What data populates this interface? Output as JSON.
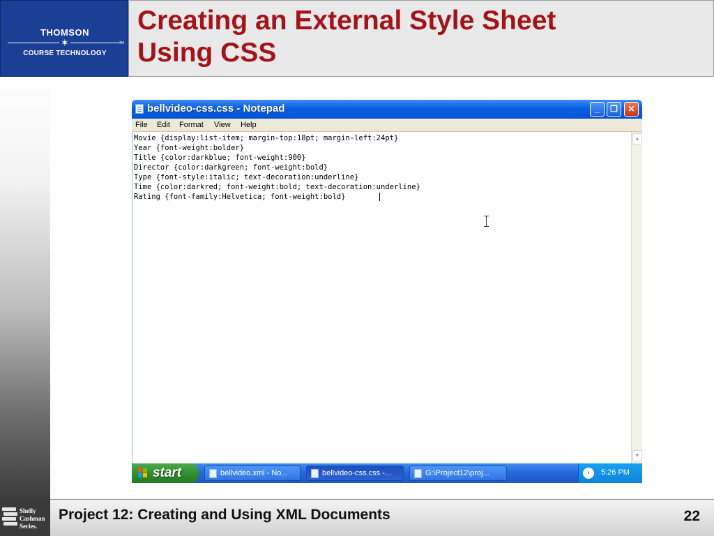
{
  "slide": {
    "logo_top": "THOMSON",
    "logo_bottom": "COURSE TECHNOLOGY",
    "logo_tm": "TM",
    "title_line1": "Creating an External Style Sheet",
    "title_line2": "Using CSS",
    "footer_text": "Project 12: Creating and Using XML Documents",
    "page_number": "22",
    "series_line1": "Shelly",
    "series_line2": "Cashman",
    "series_line3": "Series."
  },
  "window": {
    "title": "bellvideo-css.css - Notepad",
    "buttons": {
      "minimize": "_",
      "maximize": "❐",
      "close": "✕"
    }
  },
  "menu": [
    "File",
    "Edit",
    "Format",
    "View",
    "Help"
  ],
  "editor": {
    "lines": [
      "Movie {display:list-item; margin-top:18pt; margin-left:24pt}",
      "Year {font-weight:bolder}",
      "Title {color:darkblue; font-weight:900}",
      "Director {color:darkgreen; font-weight:bold}",
      "Type {font-style:italic; text-decoration:underline}",
      "Time {color:darkred; font-weight:bold; text-decoration:underline}",
      "Rating {font-family:Helvetica; font-weight:bold}"
    ]
  },
  "scrollbar": {
    "up_arrow": "▲",
    "down_arrow": "▼"
  },
  "taskbar": {
    "start_label": "start",
    "tasks": [
      "bellvideo.xml - No...",
      "bellvideo-css.css -...",
      "G:\\Project12\\proj..."
    ],
    "tray_arrow": "‹",
    "clock": "5:26 PM"
  },
  "colors": {
    "title_red": "#a3141a",
    "logo_blue": "#1b3f95",
    "xp_blue": "#0a5fe0",
    "start_green": "#2f8d2f"
  }
}
